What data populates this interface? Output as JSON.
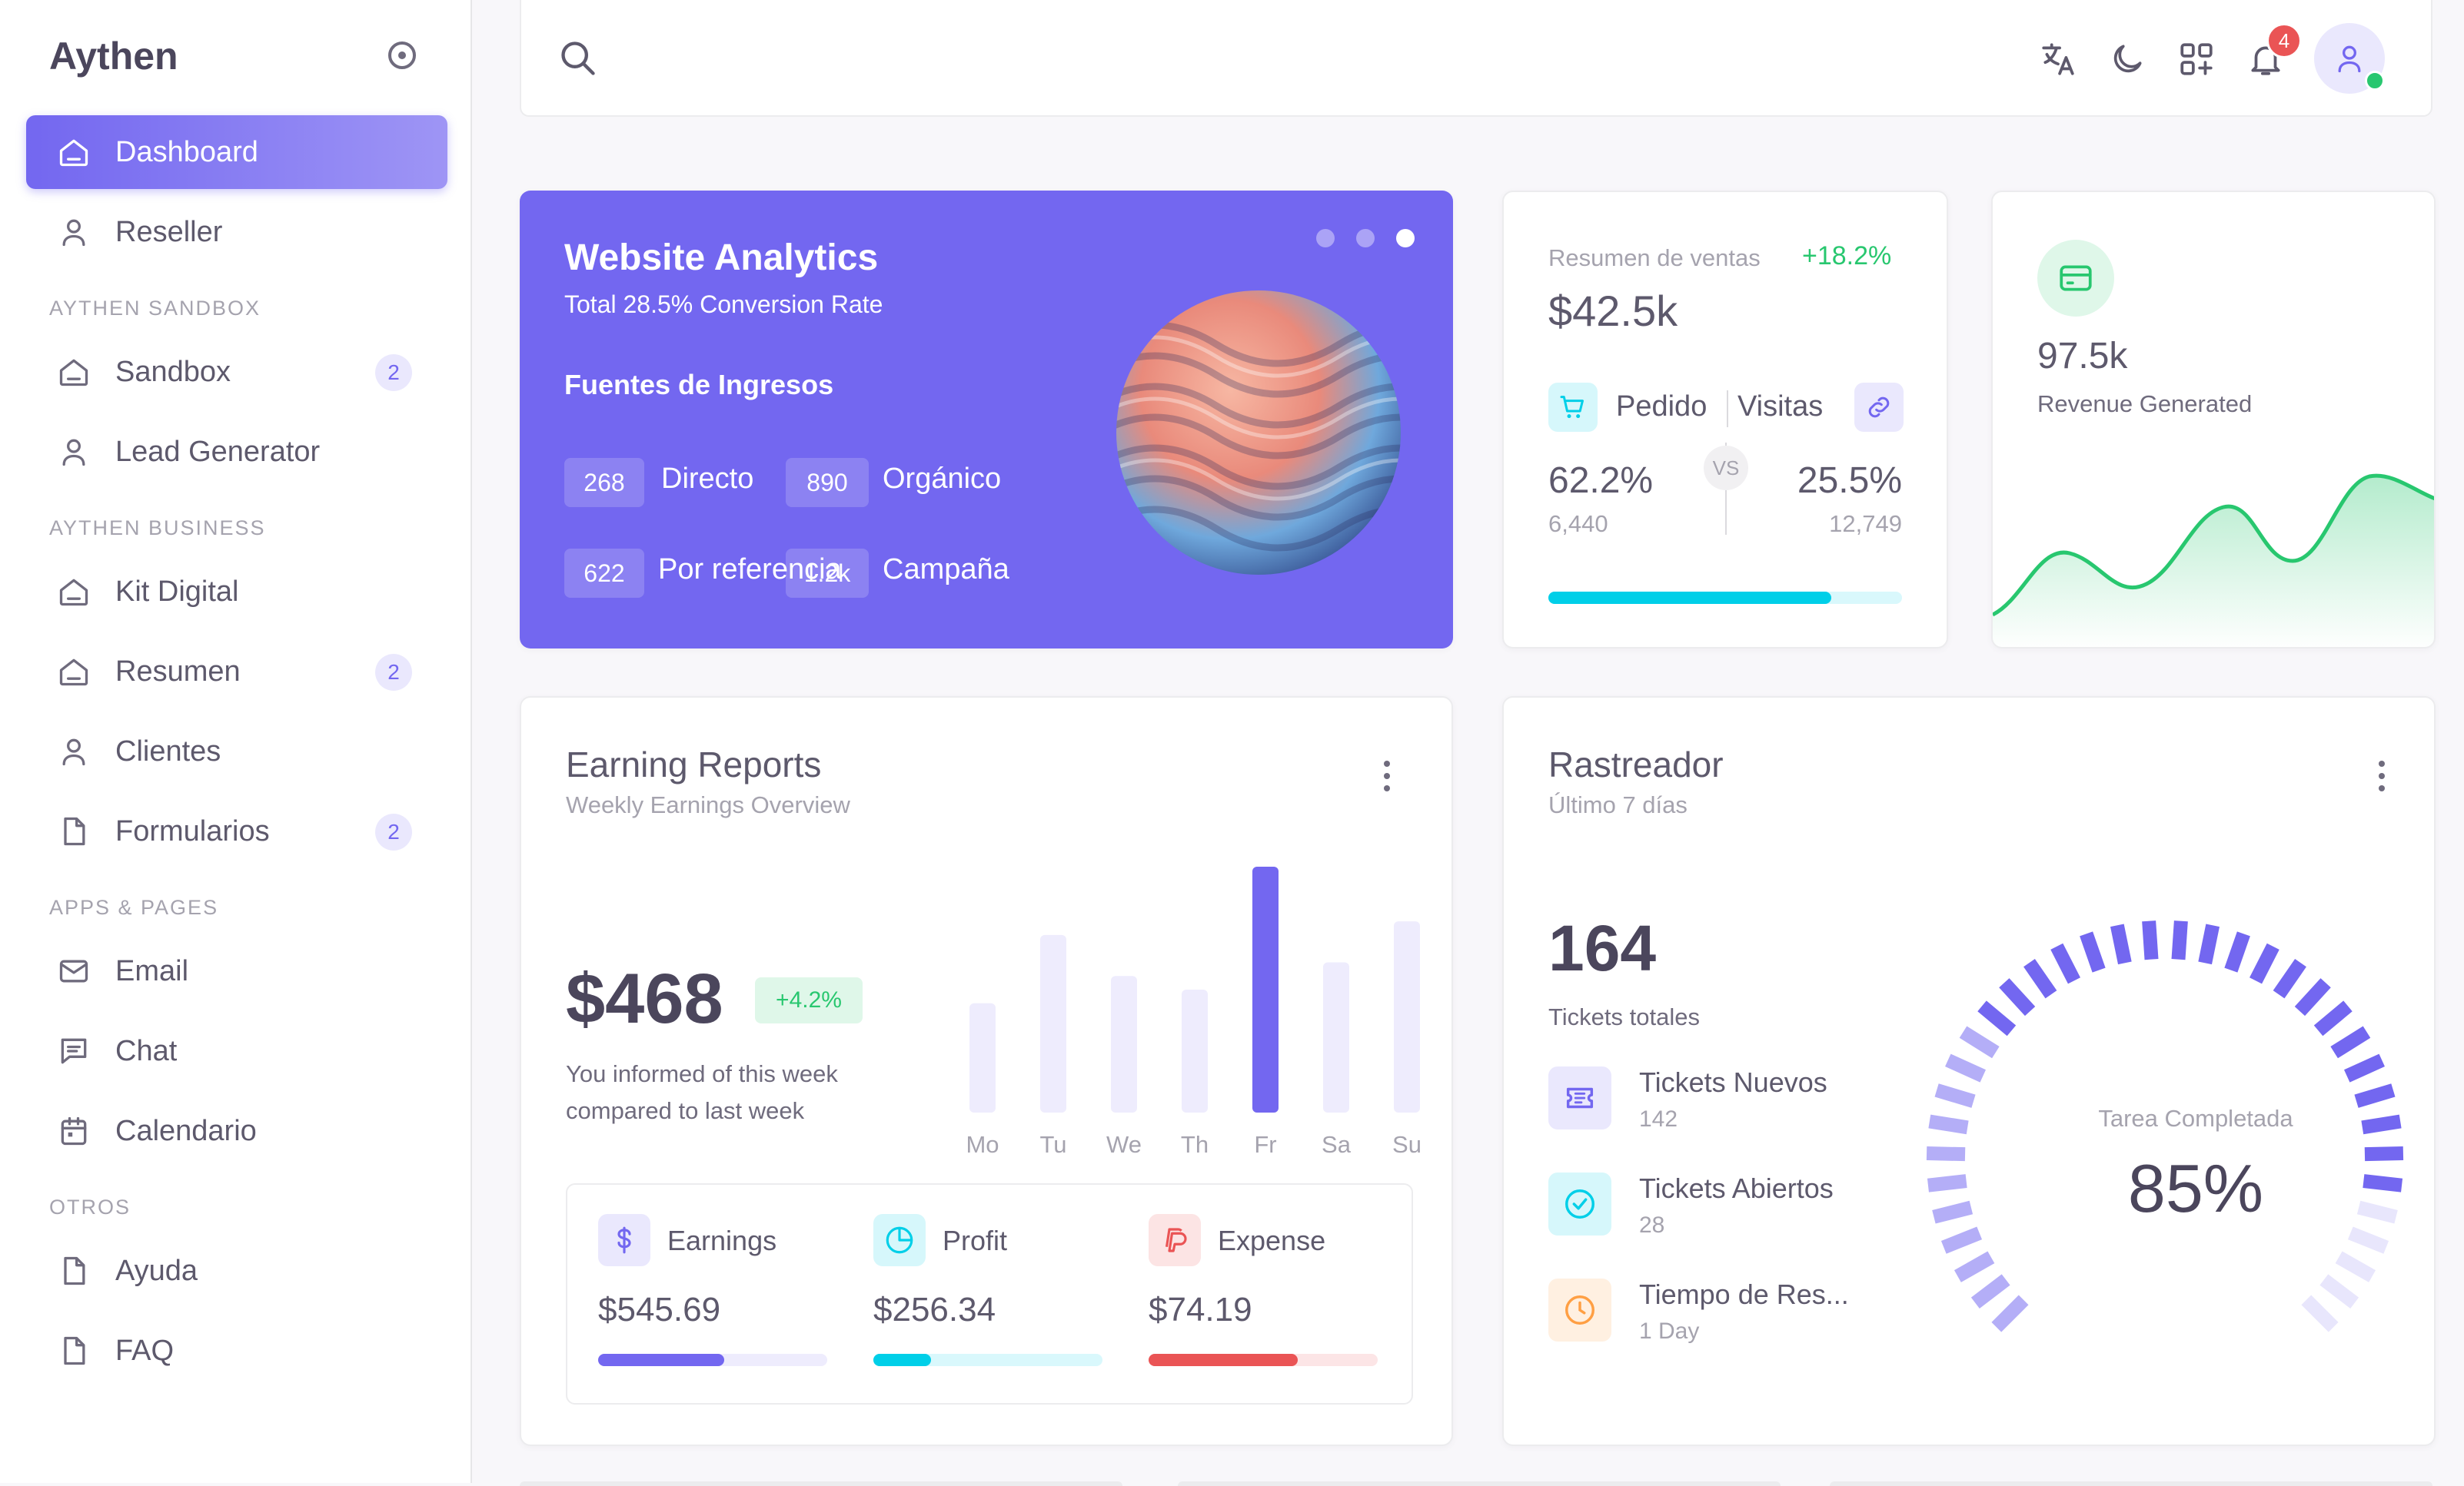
{
  "app": {
    "brand": "Aythen"
  },
  "sidebar": {
    "items": [
      {
        "label": "Dashboard",
        "icon": "home-icon",
        "active": true
      },
      {
        "label": "Reseller",
        "icon": "user-icon"
      },
      {
        "header": "AYTHEN SANDBOX"
      },
      {
        "label": "Sandbox",
        "icon": "home-icon",
        "badge": "2"
      },
      {
        "label": "Lead Generator",
        "icon": "user-icon"
      },
      {
        "header": "AYTHEN BUSINESS"
      },
      {
        "label": "Kit Digital",
        "icon": "home-icon"
      },
      {
        "label": "Resumen",
        "icon": "home-icon",
        "badge": "2"
      },
      {
        "label": "Clientes",
        "icon": "user-icon"
      },
      {
        "label": "Formularios",
        "icon": "file-icon",
        "badge": "2"
      },
      {
        "header": "APPS & PAGES"
      },
      {
        "label": "Email",
        "icon": "mail-icon"
      },
      {
        "label": "Chat",
        "icon": "chat-icon"
      },
      {
        "label": "Calendario",
        "icon": "calendar-icon"
      },
      {
        "header": "OTROS"
      },
      {
        "label": "Ayuda",
        "icon": "file-icon"
      },
      {
        "label": "FAQ",
        "icon": "file-icon"
      }
    ]
  },
  "navbar": {
    "notifications_count": "4"
  },
  "analytics": {
    "title": "Website Analytics",
    "subtitle": "Total 28.5% Conversion Rate",
    "section": "Fuentes de Ingresos",
    "sources": [
      {
        "value": "268",
        "label": "Directo"
      },
      {
        "value": "890",
        "label": "Orgánico"
      },
      {
        "value": "622",
        "label": "Por referencia"
      },
      {
        "value": "1.2k",
        "label": "Campaña"
      }
    ],
    "active_slide": 3
  },
  "sales": {
    "title": "Resumen de ventas",
    "change": "+18.2%",
    "total": "$42.5k",
    "left_label": "Pedido",
    "right_label": "Visitas",
    "vs": "VS",
    "left_pct": "62.2%",
    "left_count": "6,440",
    "right_pct": "25.5%",
    "right_count": "12,749",
    "progress": 0.8
  },
  "revenue": {
    "value": "97.5k",
    "label": "Revenue Generated"
  },
  "earning": {
    "title": "Earning Reports",
    "subtitle": "Weekly Earnings Overview",
    "amount": "$468",
    "change": "+4.2%",
    "note_line1": "You informed of this week",
    "note_line2": "compared to last week",
    "stats": [
      {
        "label": "Earnings",
        "value": "$545.69",
        "icon": "dollar-icon",
        "color": "#7367f0",
        "bg": "#eae8fd",
        "track": "#eeecfd",
        "progress": 0.55
      },
      {
        "label": "Profit",
        "value": "$256.34",
        "icon": "pie-chart-icon",
        "color": "#00cfe8",
        "bg": "#d6f7fb",
        "track": "#d9f8fc",
        "progress": 0.25
      },
      {
        "label": "Expense",
        "value": "$74.19",
        "icon": "paypal-icon",
        "color": "#ea5455",
        "bg": "#fce4e4",
        "track": "#fce5e6",
        "progress": 0.65
      }
    ]
  },
  "chart_data": {
    "type": "bar",
    "categories": [
      "Mo",
      "Tu",
      "We",
      "Th",
      "Fr",
      "Sa",
      "Su"
    ],
    "values": [
      40,
      65,
      50,
      45,
      90,
      55,
      70
    ],
    "highlight_index": 4
  },
  "tracker": {
    "title": "Rastreador",
    "subtitle": "Último 7 días",
    "total": "164",
    "total_label": "Tickets totales",
    "items": [
      {
        "label": "Tickets Nuevos",
        "value": "142",
        "icon": "ticket-icon",
        "color": "#7367f0",
        "bg": "#eae8fd"
      },
      {
        "label": "Tickets Abiertos",
        "value": "28",
        "icon": "check-circle-icon",
        "color": "#00cfe8",
        "bg": "#d6f7fb"
      },
      {
        "label": "Tiempo de Res...",
        "value": "1 Day",
        "icon": "clock-icon",
        "color": "#ff9f43",
        "bg": "#fff0e1"
      }
    ],
    "gauge_label": "Tarea Completada",
    "gauge_value": "85%",
    "gauge_fraction": 0.85
  },
  "colors": {
    "primary": "#7367f0",
    "success": "#28c76f",
    "info": "#00cfe8",
    "danger": "#ea5455",
    "warning": "#ff9f43"
  }
}
